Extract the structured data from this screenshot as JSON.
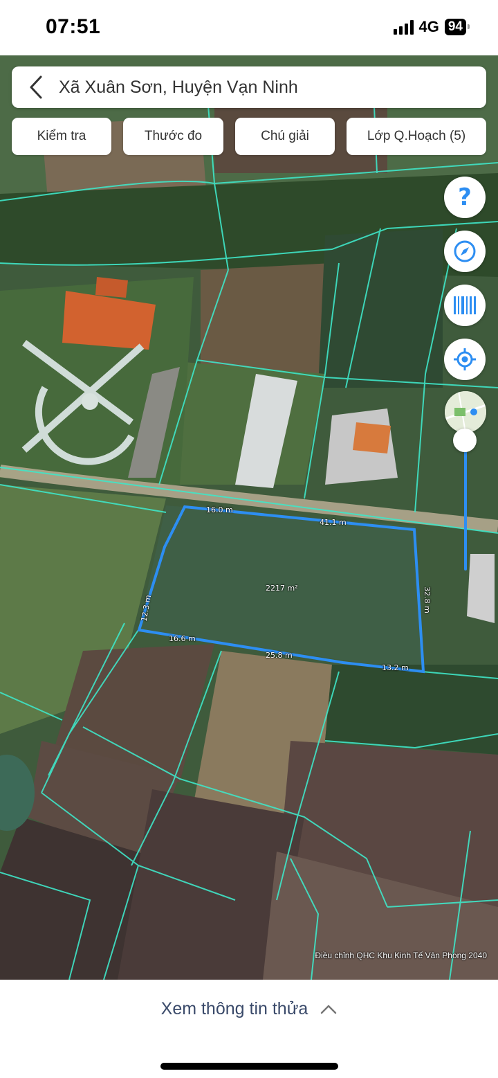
{
  "status_bar": {
    "time": "07:51",
    "network": "4G",
    "battery": "94"
  },
  "search": {
    "title": "Xã Xuân Sơn, Huyện Vạn Ninh"
  },
  "toolbar": {
    "check": "Kiểm tra",
    "measure": "Thước đo",
    "legend": "Chú giải",
    "planning_layers": "Lớp Q.Hoạch (5)"
  },
  "side_buttons": [
    "help-icon",
    "compass-icon",
    "barcode-icon",
    "locate-icon",
    "basemap-thumbnail"
  ],
  "parcel": {
    "area": "2217 m²",
    "edges": {
      "top_left": "16.0 m",
      "top_right": "41.1 m",
      "right": "32.8 m",
      "bottom_right": "13.2 m",
      "bottom_middle": "25.8 m",
      "bottom_left": "16.6 m",
      "left": "12.3 m"
    }
  },
  "attribution": "Điều chỉnh QHC Khu Kinh Tế Vân Phong 2040",
  "bottom_sheet": {
    "title": "Xem thông tin thửa"
  },
  "colors": {
    "parcel_outline": "#2d8ef2",
    "cadastral_lines": "#3fe6c8",
    "accent": "#2d8ef2"
  }
}
